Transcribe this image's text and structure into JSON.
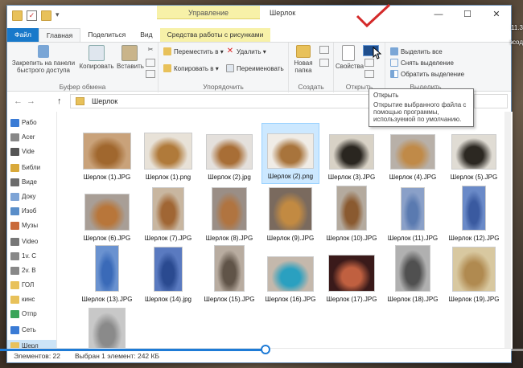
{
  "window": {
    "title": "Шерлок",
    "context_group": "Управление",
    "controls": {
      "minimize": "—",
      "maximize": "☐",
      "close": "✕"
    }
  },
  "tabs": {
    "file": "Файл",
    "home": "Главная",
    "share": "Поделиться",
    "view": "Вид",
    "picture_tools": "Средства работы с рисунками"
  },
  "ribbon": {
    "clipboard": {
      "label": "Буфер обмена",
      "pin": "Закрепить на панели быстрого доступа",
      "copy": "Копировать",
      "paste": "Вставить"
    },
    "organize": {
      "label": "Упорядочить",
      "move": "Переместить в ▾",
      "copy_to": "Копировать в ▾",
      "delete": "Удалить ▾",
      "rename": "Переименовать"
    },
    "new": {
      "label": "Создать",
      "new_folder": "Новая папка"
    },
    "open": {
      "label": "Открыть",
      "properties": "Свойства"
    },
    "select": {
      "label": "Выделить",
      "select_all": "Выделить все",
      "select_none": "Снять выделение",
      "invert": "Обратить выделение"
    }
  },
  "address": {
    "path": "Шерлок",
    "back": "←",
    "forward": "→",
    "up": "↑"
  },
  "tooltip": {
    "title": "Открыть",
    "body": "Открытие выбранного файла с помощью программы, используемой по умолчанию."
  },
  "sidebar": {
    "items": [
      {
        "label": "Рабо",
        "color": "#3a7bd5"
      },
      {
        "label": "Acer",
        "color": "#888888"
      },
      {
        "label": "Vide",
        "color": "#555555"
      },
      {
        "label": "Библи",
        "color": "#d9a93a"
      },
      {
        "label": "Виде",
        "color": "#6c6c6c"
      },
      {
        "label": "Доку",
        "color": "#7ea4d6"
      },
      {
        "label": "Изоб",
        "color": "#5a8ec9"
      },
      {
        "label": "Музы",
        "color": "#c96a3a"
      },
      {
        "label": "Video",
        "color": "#777777"
      },
      {
        "label": "1v. C",
        "color": "#888888"
      },
      {
        "label": "2v. B",
        "color": "#888888"
      },
      {
        "label": "ГОЛ",
        "color": "#e8c15a"
      },
      {
        "label": "кинс",
        "color": "#e8c15a"
      },
      {
        "label": "Отпр",
        "color": "#3aa55a"
      },
      {
        "label": "Сеть",
        "color": "#3a7bd5"
      },
      {
        "label": "Шерл",
        "color": "#e8c15a"
      }
    ]
  },
  "files": [
    {
      "name": "Шерлок (1).JPG",
      "c1": "#c9a27a",
      "c2": "#a0672e"
    },
    {
      "name": "Шерлок (1).png",
      "c1": "#e8e2d8",
      "c2": "#b07a3a"
    },
    {
      "name": "Шерлок (2).jpg",
      "c1": "#e4e0dc",
      "c2": "#a86e36"
    },
    {
      "name": "Шерлок (2).png",
      "c1": "#f0ece6",
      "c2": "#a8743c"
    },
    {
      "name": "Шерлок (3).JPG",
      "c1": "#d8d2c6",
      "c2": "#2a2620"
    },
    {
      "name": "Шерлок (4).JPG",
      "c1": "#b8b0a8",
      "c2": "#c08a48"
    },
    {
      "name": "Шерлок (5).JPG",
      "c1": "#e0dcd4",
      "c2": "#2c2822"
    },
    {
      "name": "Шерлок (6).JPG",
      "c1": "#a89e96",
      "c2": "#b8763a"
    },
    {
      "name": "Шерлок (7).JPG",
      "c1": "#c8b6a0",
      "c2": "#a06634"
    },
    {
      "name": "Шерлок (8).JPG",
      "c1": "#9a8e86",
      "c2": "#b07440"
    },
    {
      "name": "Шерлок (9).JPG",
      "c1": "#7a6a5e",
      "c2": "#c28a42"
    },
    {
      "name": "Шерлок (10).JPG",
      "c1": "#b4aa9e",
      "c2": "#8a5a30"
    },
    {
      "name": "Шерлок (11).JPG",
      "c1": "#8aa0c8",
      "c2": "#5a7ab0"
    },
    {
      "name": "Шерлок (12).JPG",
      "c1": "#6a8ac8",
      "c2": "#3a5aa0"
    },
    {
      "name": "Шерлок (13).JPG",
      "c1": "#6a92d0",
      "c2": "#3a6ab8"
    },
    {
      "name": "Шерлок (14).jpg",
      "c1": "#5a7ac0",
      "c2": "#2a4a90"
    },
    {
      "name": "Шерлок (15).JPG",
      "c1": "#b8aca0",
      "c2": "#605448"
    },
    {
      "name": "Шерлок (16).JPG",
      "c1": "#c4b8ac",
      "c2": "#2aa0c0"
    },
    {
      "name": "Шерлок (17).JPG",
      "c1": "#3a1a1a",
      "c2": "#c06040"
    },
    {
      "name": "Шерлок (18).JPG",
      "c1": "#b0b0b0",
      "c2": "#505050"
    },
    {
      "name": "Шерлок (19).JPG",
      "c1": "#d8c8a0",
      "c2": "#b08a50"
    },
    {
      "name": "",
      "c1": "#c8c8c8",
      "c2": "#8a8a8a"
    }
  ],
  "status": {
    "count": "Элементов: 22",
    "selected": "Выбран 1 элемент: 242 КБ"
  },
  "taskbar": {
    "text1": "11.3",
    "text2": "зсод"
  }
}
